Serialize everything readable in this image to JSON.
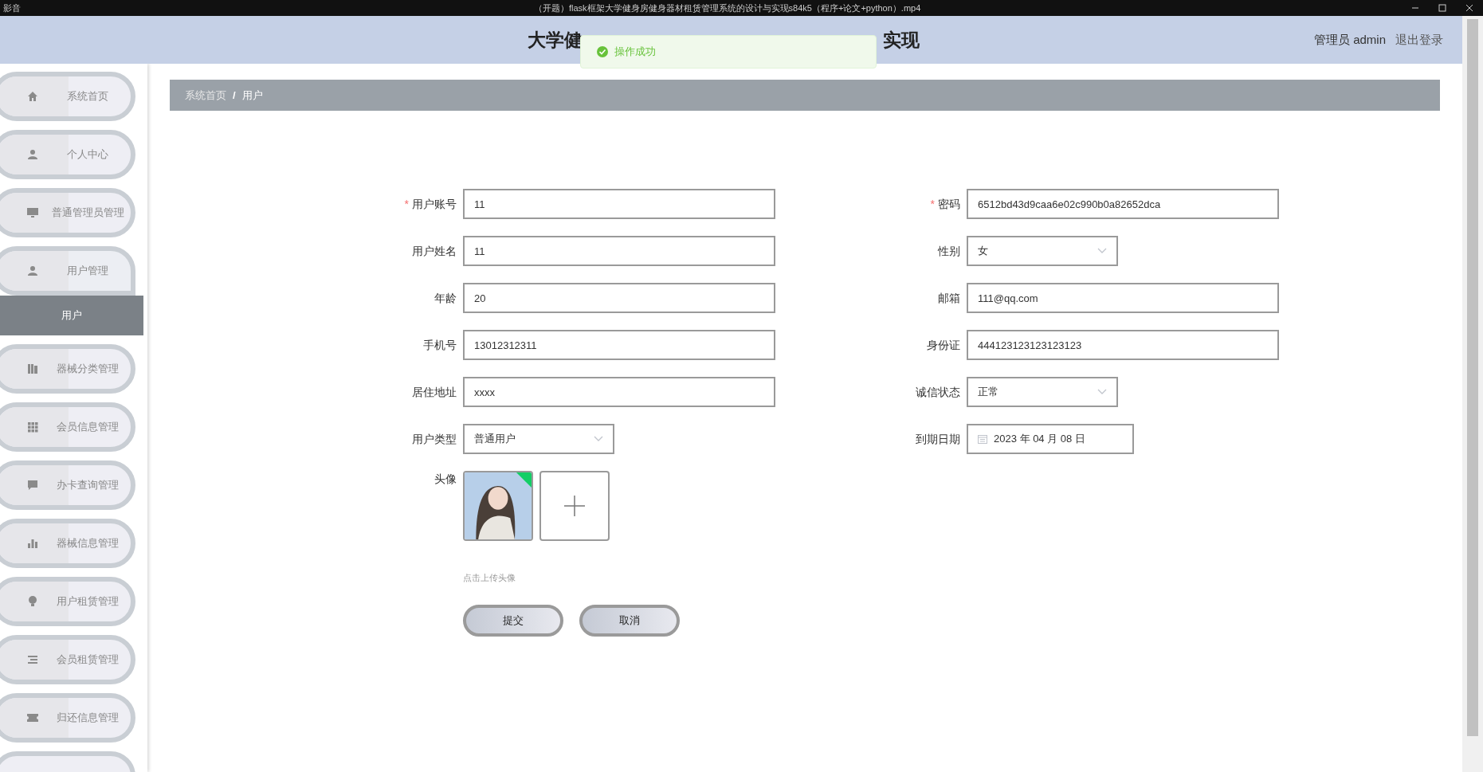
{
  "player": {
    "app_label": "影音",
    "file_title": "（开题）flask框架大学健身房健身器材租赁管理系统的设计与实现s84k5（程序+论文+python）.mp4"
  },
  "header": {
    "title_left": "大学健",
    "title_right": "实现",
    "role": "管理员 admin",
    "logout": "退出登录"
  },
  "toast": {
    "message": "操作成功"
  },
  "sidebar": {
    "items": [
      {
        "label": "系统首页",
        "expanded": false
      },
      {
        "label": "个人中心",
        "expanded": false
      },
      {
        "label": "普通管理员管理",
        "expanded": false
      },
      {
        "label": "用户管理",
        "expanded": true,
        "children": [
          {
            "label": "用户",
            "selected": true
          }
        ]
      },
      {
        "label": "器械分类管理",
        "expanded": false
      },
      {
        "label": "会员信息管理",
        "expanded": false
      },
      {
        "label": "办卡查询管理",
        "expanded": false
      },
      {
        "label": "器械信息管理",
        "expanded": false
      },
      {
        "label": "用户租赁管理",
        "expanded": false
      },
      {
        "label": "会员租赁管理",
        "expanded": false
      },
      {
        "label": "归还信息管理",
        "expanded": false
      }
    ]
  },
  "breadcrumb": {
    "separator": "/",
    "items": [
      "系统首页",
      "用户"
    ]
  },
  "form": {
    "required_mark": "*",
    "left": [
      {
        "kind": "text",
        "label": "用户账号",
        "required": true,
        "value": "11"
      },
      {
        "kind": "text",
        "label": "用户姓名",
        "required": false,
        "value": "11"
      },
      {
        "kind": "text",
        "label": "年龄",
        "required": false,
        "value": "20"
      },
      {
        "kind": "text",
        "label": "手机号",
        "required": false,
        "value": "13012312311"
      },
      {
        "kind": "text",
        "label": "居住地址",
        "required": false,
        "value": "xxxx"
      },
      {
        "kind": "select",
        "label": "用户类型",
        "required": false,
        "value": "普通用户"
      }
    ],
    "right": [
      {
        "kind": "text",
        "label": "密码",
        "required": true,
        "value": "6512bd43d9caa6e02c990b0a82652dca"
      },
      {
        "kind": "select",
        "label": "性别",
        "required": false,
        "value": "女"
      },
      {
        "kind": "text",
        "label": "邮箱",
        "required": false,
        "value": "111@qq.com"
      },
      {
        "kind": "text",
        "label": "身份证",
        "required": false,
        "value": "444123123123123123"
      },
      {
        "kind": "select",
        "label": "诚信状态",
        "required": false,
        "value": "正常"
      },
      {
        "kind": "date",
        "label": "到期日期",
        "required": false,
        "value": "2023 年 04 月 08 日"
      }
    ],
    "avatar": {
      "label": "头像",
      "hint": "点击上传头像"
    },
    "buttons": [
      "提交",
      "取消"
    ]
  }
}
